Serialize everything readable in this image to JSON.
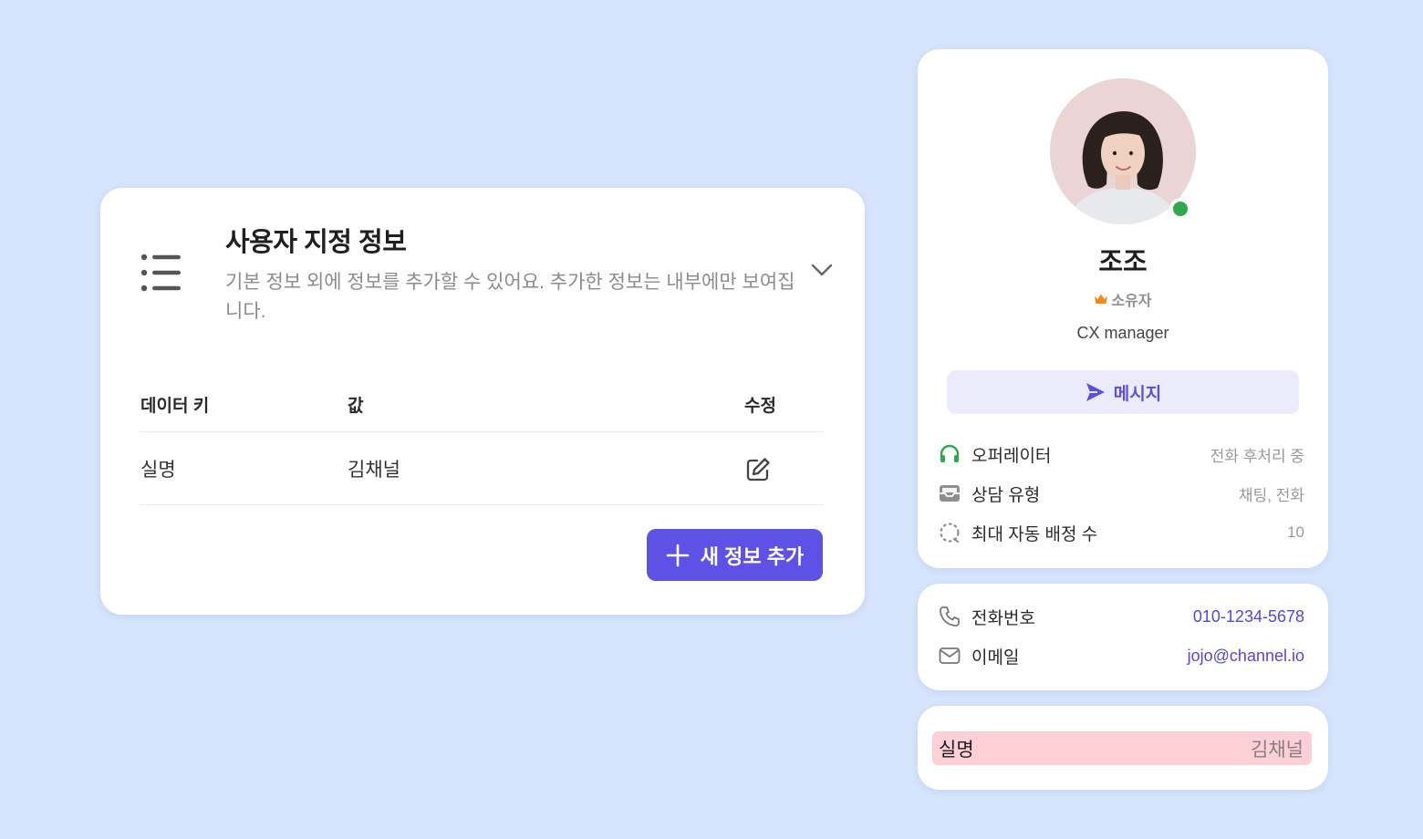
{
  "custom_info": {
    "title": "사용자 지정 정보",
    "description": "기본 정보 외에 정보를 추가할 수 있어요. 추가한 정보는 내부에만 보여집니다.",
    "columns": {
      "key": "데이터 키",
      "value": "값",
      "edit": "수정"
    },
    "rows": [
      {
        "key": "실명",
        "value": "김채널"
      }
    ],
    "add_button_label": "새 정보 추가",
    "colors": {
      "accent": "#5e52e6"
    }
  },
  "profile": {
    "name": "조조",
    "role": "소유자",
    "job_title": "CX manager",
    "status_color": "#2fa84f",
    "message_button_label": "메시지",
    "details": [
      {
        "label": "오퍼레이터",
        "value": "전화 후처리 중",
        "icon": "headset-icon"
      },
      {
        "label": "상담 유형",
        "value": "채팅, 전화",
        "icon": "inbox-icon"
      },
      {
        "label": "최대 자동 배정 수",
        "value": "10",
        "icon": "dashed-circle-icon"
      }
    ]
  },
  "contact": [
    {
      "label": "전화번호",
      "value": "010-1234-5678",
      "icon": "phone-icon"
    },
    {
      "label": "이메일",
      "value": "jojo@channel.io",
      "icon": "mail-icon"
    }
  ],
  "highlight": {
    "key": "실명",
    "value": "김채널",
    "color": "#fdd0d5"
  }
}
